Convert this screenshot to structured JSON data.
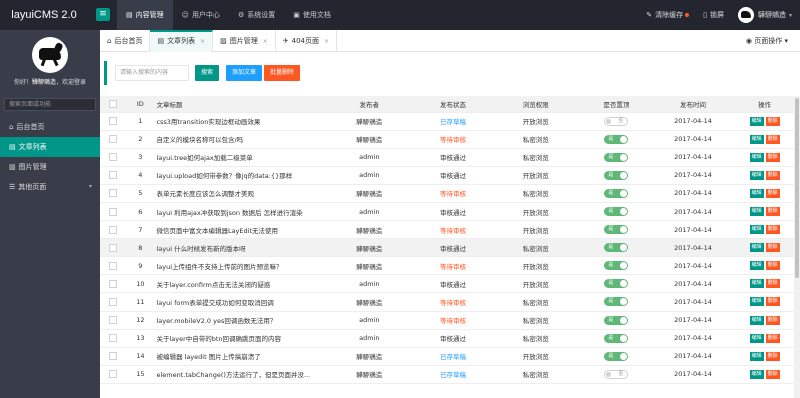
{
  "app": {
    "title": "layuiCMS 2.0"
  },
  "top_nav": [
    {
      "icon": "▤",
      "label": "内容管理"
    },
    {
      "icon": "☺",
      "label": "用户中心"
    },
    {
      "icon": "⚙",
      "label": "系统设置"
    },
    {
      "icon": "▣",
      "label": "使用文档"
    }
  ],
  "top_right": {
    "clear_cache": "清除缓存",
    "lock": "锁屏",
    "username": "驊駵鵷造"
  },
  "sidebar": {
    "welcome_prefix": "你好！",
    "welcome_name": "驊駵鵷造",
    "welcome_suffix": "，欢迎登录",
    "search_placeholder": "搜索页面或功能",
    "items": [
      {
        "icon": "⌂",
        "label": "后台首页"
      },
      {
        "icon": "▤",
        "label": "文章列表"
      },
      {
        "icon": "▨",
        "label": "图片管理"
      },
      {
        "icon": "☰",
        "label": "其他页面"
      }
    ]
  },
  "tabs": [
    {
      "icon": "⌂",
      "label": "后台首页",
      "closable": false
    },
    {
      "icon": "▤",
      "label": "文章列表",
      "closable": true
    },
    {
      "icon": "▨",
      "label": "图片管理",
      "closable": true
    },
    {
      "icon": "✈",
      "label": "404页面",
      "closable": true
    }
  ],
  "tab_close": "×",
  "page_ops": "◉ 页面操作 ▾",
  "toolbar": {
    "search_placeholder": "请输入搜索的内容",
    "search_label": "搜索",
    "add_label": "添加文章",
    "batch_delete_label": "批量删除"
  },
  "table": {
    "headers": [
      "",
      "ID",
      "文章标题",
      "发布者",
      "发布状态",
      "浏览权限",
      "是否置顶",
      "发布时间",
      "操作"
    ],
    "switch_on": "是",
    "switch_off": "否",
    "edit_label": "编辑",
    "delete_label": "删除",
    "rows": [
      {
        "id": "1",
        "title": "css3用transition实现边框动画效果",
        "author": "驊駵鵷造",
        "status": "已存草稿",
        "status_type": "draft",
        "access": "开放浏览",
        "top": false,
        "date": "2017-04-14"
      },
      {
        "id": "2",
        "title": "自定义的模块名称可以包含/吗",
        "author": "驊駵鵷造",
        "status": "等待审核",
        "status_type": "unreview",
        "access": "私密浏览",
        "top": true,
        "date": "2017-04-14"
      },
      {
        "id": "3",
        "title": "layui.tree如何ajax加载二级菜单",
        "author": "admin",
        "status": "审核通过",
        "status_type": "pass",
        "access": "私密浏览",
        "top": true,
        "date": "2017-04-14"
      },
      {
        "id": "4",
        "title": "layui.upload如何带参数？像jq的data:{}那样",
        "author": "admin",
        "status": "审核通过",
        "status_type": "pass",
        "access": "开放浏览",
        "top": true,
        "date": "2017-04-14"
      },
      {
        "id": "5",
        "title": "表单元素长度应该怎么调整才美观",
        "author": "驊駵鵷造",
        "status": "等待审核",
        "status_type": "unreview",
        "access": "私密浏览",
        "top": true,
        "date": "2017-04-14"
      },
      {
        "id": "6",
        "title": "layui 利用ajax冲获取到json 数据后 怎样进行渲染",
        "author": "admin",
        "status": "审核通过",
        "status_type": "pass",
        "access": "开放浏览",
        "top": true,
        "date": "2017-04-14"
      },
      {
        "id": "7",
        "title": "微信页面中富文本编辑器LayEdit无法使用",
        "author": "驊駵鵷造",
        "status": "等待审核",
        "status_type": "unreview",
        "access": "开放浏览",
        "top": true,
        "date": "2017-04-14"
      },
      {
        "id": "8",
        "title": "layui 什么时候发布新的版本呀",
        "author": "驊駵鵷造",
        "status": "审核通过",
        "status_type": "pass",
        "access": "私密浏览",
        "top": true,
        "date": "2017-04-14",
        "highlight": true
      },
      {
        "id": "9",
        "title": "layui上传组件不支持上传前的图片预览嘛？",
        "author": "驊駵鵷造",
        "status": "等待审核",
        "status_type": "unreview",
        "access": "开放浏览",
        "top": true,
        "date": "2017-04-14"
      },
      {
        "id": "10",
        "title": "关于layer.confirm点击无法关闭的疑惑",
        "author": "admin",
        "status": "审核通过",
        "status_type": "pass",
        "access": "开放浏览",
        "top": true,
        "date": "2017-04-14"
      },
      {
        "id": "11",
        "title": "layui form表单提交成功如何变取消回调",
        "author": "驊駵鵷造",
        "status": "等待审核",
        "status_type": "unreview",
        "access": "私密浏览",
        "top": true,
        "date": "2017-04-14"
      },
      {
        "id": "12",
        "title": "layer.mobileV2.0 yes回调函数无法用？",
        "author": "admin",
        "status": "等待审核",
        "status_type": "unreview",
        "access": "私密浏览",
        "top": true,
        "date": "2017-04-14"
      },
      {
        "id": "13",
        "title": "关于layer中自带的btn回调确跳页面的内容",
        "author": "admin",
        "status": "审核通过",
        "status_type": "pass",
        "access": "私密浏览",
        "top": true,
        "date": "2017-04-14"
      },
      {
        "id": "14",
        "title": "被编辑器 layedit 图片上传搞崩溃了",
        "author": "驊駵鵷造",
        "status": "已存草稿",
        "status_type": "draft",
        "access": "开放浏览",
        "top": true,
        "date": "2017-04-14"
      },
      {
        "id": "15",
        "title": "element.tabChange()方法运行了，但是页面并没...",
        "author": "驊駵鵷造",
        "status": "已存草稿",
        "status_type": "draft",
        "access": "私密浏览",
        "top": false,
        "date": "2017-04-14"
      }
    ]
  },
  "colors": {
    "accent": "#009688",
    "header_bg": "#23262e",
    "sidebar_bg": "#393d49",
    "danger": "#ff5722",
    "info": "#1e9fff",
    "switch_on": "#5fb878"
  }
}
